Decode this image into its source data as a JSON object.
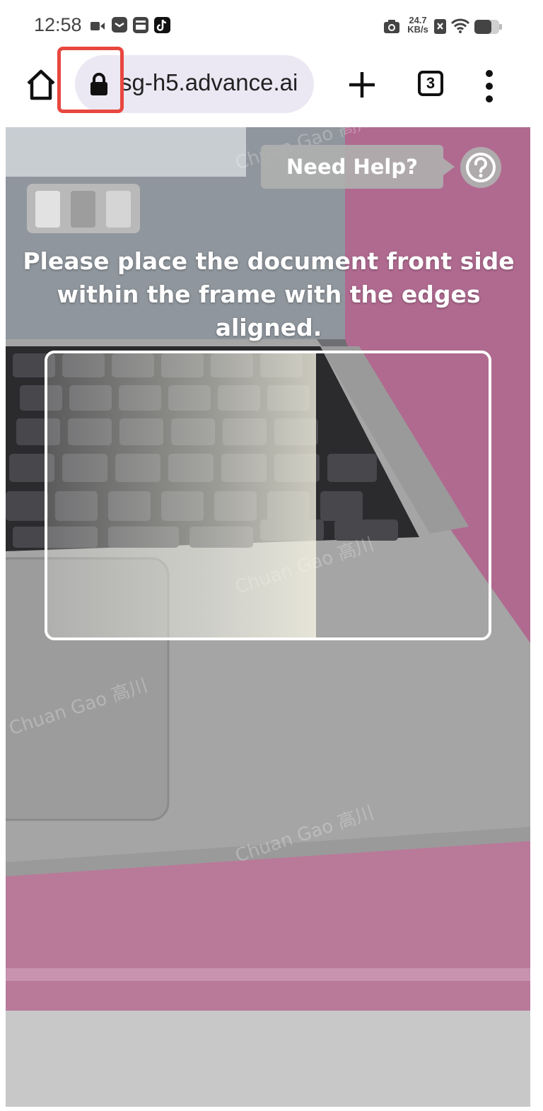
{
  "status_bar": {
    "time": "12:58",
    "network_speed_value": "24.7",
    "network_speed_unit": "KB/s",
    "icons": [
      "video-camera-icon",
      "messenger-icon",
      "sim-icon",
      "tiktok-icon",
      "camera-icon",
      "no-signal-icon",
      "wifi-icon",
      "battery-icon"
    ]
  },
  "browser": {
    "url": "sg-h5.advance.ai",
    "tab_count": "3",
    "icons": [
      "home-icon",
      "lock-icon",
      "plus-icon",
      "more-vertical-icon"
    ]
  },
  "capture": {
    "help_label": "Need Help?",
    "help_icon": "question-circle-icon",
    "instruction": "Please place the document front side within the frame with the edges aligned."
  },
  "watermark": {
    "text": "Chuan Gao 高川"
  },
  "colors": {
    "highlight": "#e8473f",
    "url_pill": "#ebe8f3"
  }
}
